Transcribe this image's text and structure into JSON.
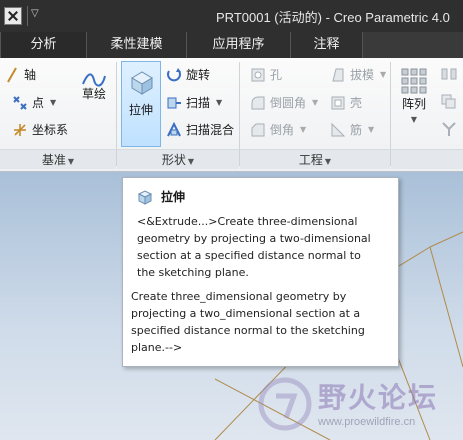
{
  "titlebar": {
    "title": "PRT0001 (活动的) - Creo Parametric 4.0"
  },
  "tabs": [
    {
      "label": "分析"
    },
    {
      "label": "柔性建模"
    },
    {
      "label": "应用程序"
    },
    {
      "label": "注释"
    }
  ],
  "ribbon": {
    "datum": {
      "group_label": "基准",
      "axis_label": "轴",
      "point_label": "点",
      "csys_label": "坐标系",
      "sketch_label": "草绘"
    },
    "shapes": {
      "group_label": "形状",
      "extrude_label": "拉伸",
      "revolve_label": "旋转",
      "sweep_label": "扫描",
      "swept_blend_label": "扫描混合"
    },
    "engineering": {
      "group_label": "工程",
      "hole_label": "孔",
      "draft_label": "拔模",
      "round_label": "倒圆角",
      "shell_label": "壳",
      "chamfer_label": "倒角",
      "rib_label": "筋"
    },
    "pattern": {
      "label": "阵列"
    }
  },
  "tooltip": {
    "title": "拉伸",
    "description": "<&Extrude...>Create three-dimensional geometry by projecting a two-dimensional section at a specified distance normal to the sketching plane.",
    "description2": "Create three_dimensional geometry by projecting a two_dimensional section at a specified distance normal to the sketching plane.-->"
  },
  "watermark": {
    "text": "野火论坛",
    "url": "www.proewildfire.cn"
  },
  "colors": {
    "titlebar_bg": "#2f2f2f",
    "tab_bg": "#2f2f2f",
    "active_button": "#bfe1ff",
    "sketch_lines": "#b08a4a"
  }
}
